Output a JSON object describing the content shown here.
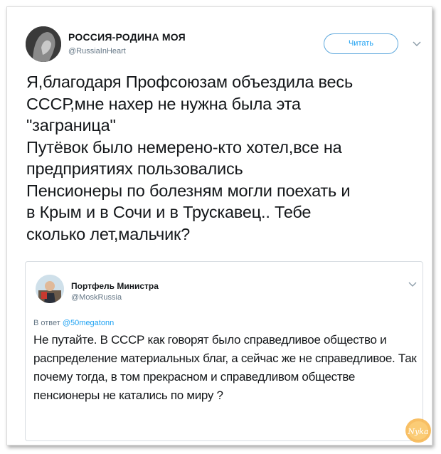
{
  "tweet": {
    "author_name": "РОССИЯ-РОДИНА МОЯ",
    "author_handle": "@RussiaInHeart",
    "follow_label": "Читать",
    "text": "Я,благодаря Профсоюзам объездила весь\nСССР,мне нахер не нужна была эта\n\"заграница\"\nПутёвок было немерено-кто хотел,все на\nпредприятиях пользовались\nПенсионеры по болезням могли поехать и\nв Крым и в Сочи и в Трускавец.. Тебе\nсколько лет,мальчик?"
  },
  "quoted_tweet": {
    "author_name": "Портфель Министра",
    "author_handle": "@MoskRussia",
    "reply_prefix": "В ответ ",
    "reply_to": "@50megatonn",
    "text": "Не путайте. В СССР как говорят было справедливое общество и распределение материальных благ, а сейчас же не справедливое. Так почему тогда, в том прекрасном и справедливом обществе пенсионеры не катались по миру ?"
  },
  "watermark": {
    "text": "Nyka"
  },
  "colors": {
    "accent": "#1da1f2",
    "text": "#14171a",
    "muted": "#657786",
    "watermark": "#f4a63a"
  },
  "icons": {
    "caret": "chevron-down-icon"
  }
}
